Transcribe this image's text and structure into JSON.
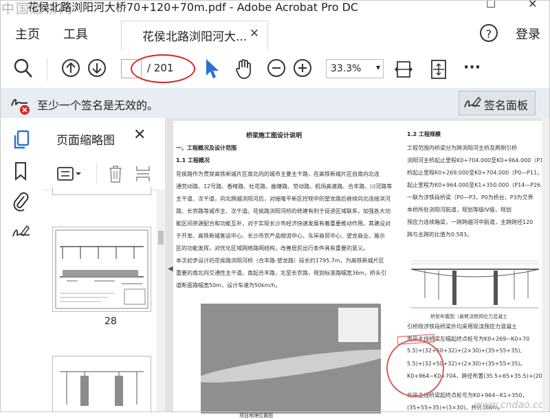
{
  "window": {
    "watermark": "中国道桥网",
    "title": "花侯北路浏阳河大桥70+120+70m.pdf - Adobe Acrobat Pro DC"
  },
  "menu": {
    "home": "主页",
    "tools": "工具",
    "tab_label": "花侯北路浏阳河大...",
    "login": "登录"
  },
  "toolbar": {
    "page_current": "",
    "page_total": "/ 201",
    "zoom": "33.3%"
  },
  "notice": {
    "text": "至少一个签名是无效的。",
    "panel_button": "签名面板"
  },
  "thumbnails": {
    "title": "页面缩略图",
    "page_number": "28"
  },
  "document": {
    "title": "桥梁施工图设计说明",
    "sec1": "一、工程概况及设计范围",
    "sec1_1": "1.1 工程概况",
    "body_lines": [
      "花侯路作为贯穿高铁新城片区南北向的城市主要主干路，在高铁新城片区自南向北连",
      "通劳动路、12号路、香樟路、杜花路、曲塘路、劳动路、机场高速路、合丰路、川河路等",
      "主干道、次干道，向北跨越浏阳河后，对接隆平新区控规中的望龙路后继续向北连接滨河",
      "路、长农路等城市主、次干道。花侯路浏阳河桥的修建有利于促进区域联系，加强各大功",
      "能区间资源配合和功能互补，对于实现长沙市经济快速发展有着重要推动作用。其建设对",
      "于开发、高铁新城客运中心、长沙市农产品物流中心、东岸商贸中心、望龙商业、展示",
      "区的功能发挥，对优化区域网络路网结构，改善居民出行条件具有重要的意义。",
      "本次初步设计的花侯路浏阳河桥（合丰路-望龙路）段长约1795.7m，为高铁新城片区",
      "重要的南北向交通性主干道。南起合丰路，北至长农路，规划标准路幅宽36m，桥头引",
      "道断面路幅宽50m，设计车速为50km/h。"
    ],
    "map_caption": "项目地理位置图",
    "right_heading": "1.2 工程规模",
    "right_lines": [
      "工程范围内桥梁分为跨浏阳河主桥及两侧引桥",
      "浏阳河主桥起止里程K0+704.000至K0+964.000（P11",
      "桥起止里程K0+269.000至K0+704.000（P0—P11，P",
      "起止里程为K0+964.000至K1+350.000（P14—P26，",
      "一联为涉铁段桥梁（P0—P3，P0为桥台，P3为交界",
      "本桥所处浏阳河航道，规划等级IV级，规划",
      "预应力连续箱梁，一跨跨越河中航道，主跨跨径120",
      "跨与主跨的比值为0.583。"
    ],
    "bridge_caption": "桥型布置图（悬臂浇筑预应力混凝土",
    "right_lines2": [
      "引桥除涉铁段桥梁外均采用现浇预应力混凝土",
      "南岸主线桥梁左幅起终点桩号为K0+269~K0+70",
      "5.5)+(32+50+32)+(2×30)+(35+55+35),",
      "5.5)+(32+50+32)+(2×30)+(35+55+35)。",
      "K0+964~K0+704，跨径布置(35.5+65+35.5)+(20+32+",
      "北岸主线桥梁起终点桩号为K0+964~K1+350，",
      "(35+55+35)+(3×30)，共计386m。"
    ],
    "website": "www.cndao.com"
  }
}
